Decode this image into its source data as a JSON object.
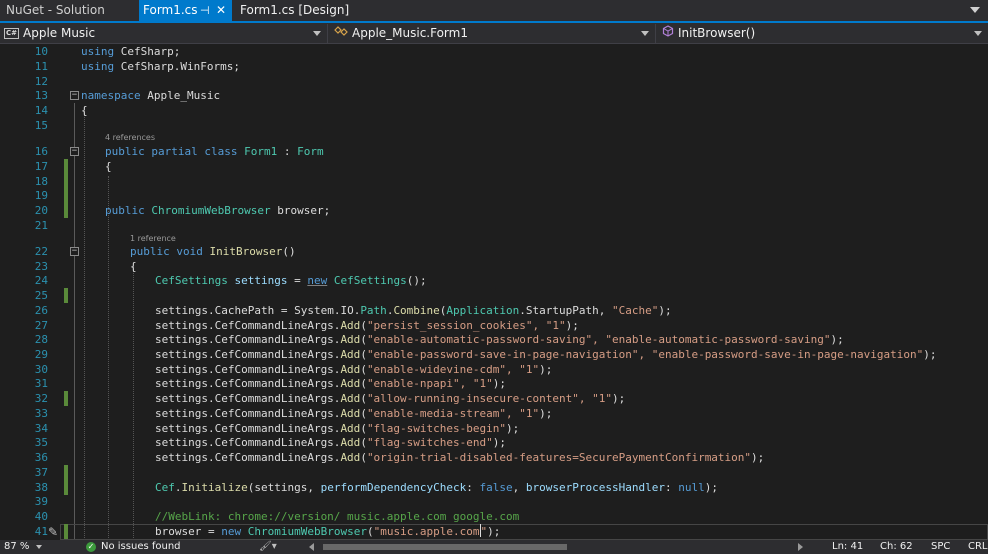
{
  "tabs": {
    "solution_label": "NuGet - Solution",
    "active_label": "Form1.cs",
    "design_label": "Form1.cs [Design]"
  },
  "navbar": {
    "project_badge": "C#",
    "project": "Apple Music",
    "class": "Apple_Music.Form1",
    "member": "InitBrowser()"
  },
  "editor": {
    "line_numbers": [
      "10",
      "11",
      "12",
      "13",
      "14",
      "15",
      "16",
      "17",
      "18",
      "19",
      "20",
      "21",
      "22",
      "23",
      "24",
      "25",
      "26",
      "27",
      "28",
      "29",
      "30",
      "31",
      "32",
      "33",
      "34",
      "35",
      "36",
      "37",
      "38",
      "39",
      "40",
      "41"
    ],
    "codelens": {
      "class_refs": "4 references",
      "method_refs": "1 reference"
    },
    "lines": {
      "l10_kw": "using",
      "l10_rest": " CefSharp;",
      "l11_kw": "using",
      "l11_rest": " CefSharp.WinForms;",
      "l13_kw": "namespace",
      "l13_rest": " Apple_Music",
      "l14": "{",
      "l16_kw": "public partial class",
      "l16_type": "Form1",
      "l16_colon": " : ",
      "l16_base": "Form",
      "l17": "{",
      "l20_kw": "public",
      "l20_type": "ChromiumWebBrowser",
      "l20_rest": " browser;",
      "l22_kw": "public void",
      "l22_name": "InitBrowser",
      "l22_rest": "()",
      "l23": "{",
      "l24_type": "CefSettings",
      "l24_var": "settings",
      "l24_eq": " = ",
      "l24_new": "new",
      "l24_type2": "CefSettings",
      "l24_end": "();",
      "l26_a": "settings.",
      "l26_b": "CachePath",
      "l26_c": " = System.IO.",
      "l26_d": "Path",
      "l26_e": ".",
      "l26_f": "Combine",
      "l26_g": "(",
      "l26_h": "Application",
      "l26_i": ".",
      "l26_j": "StartupPath",
      "l26_k": ", ",
      "l26_l": "\"Cache\"",
      "l26_m": ");",
      "args_prefix": "settings.CefCommandLineArgs.",
      "args_add": "Add",
      "l27_args": "\"persist_session_cookies\", \"1\"",
      "l28_args": "\"enable-automatic-password-saving\", \"enable-automatic-password-saving\"",
      "l29_args": "\"enable-password-save-in-page-navigation\", \"enable-password-save-in-page-navigation\"",
      "l30_args": "\"enable-widevine-cdm\", \"1\"",
      "l31_args": "\"enable-npapi\", \"1\"",
      "l32_args": "\"allow-running-insecure-content\", \"1\"",
      "l33_args": "\"enable-media-stream\", \"1\"",
      "l34_args": "\"flag-switches-begin\"",
      "l35_args": "\"flag-switches-end\"",
      "l36_args": "\"origin-trial-disabled-features=SecurePaymentConfirmation\"",
      "l38_a": "Cef",
      "l38_b": ".",
      "l38_c": "Initialize",
      "l38_d": "(settings, ",
      "l38_e": "performDependencyCheck",
      "l38_f": ": ",
      "l38_g": "false",
      "l38_h": ", ",
      "l38_i": "browserProcessHandler",
      "l38_j": ": ",
      "l38_k": "null",
      "l38_l": ");",
      "l40_comment": "//WebLink: chrome://version/ music.apple.com google.com",
      "l41_a": "browser = ",
      "l41_new": "new",
      "l41_type": "ChromiumWebBrowser",
      "l41_str_a": "\"music.apple.com",
      "l41_str_b": "\"",
      "l41_end": ");"
    }
  },
  "status": {
    "zoom": "87 %",
    "issues": "No issues found",
    "line": "Ln: 41",
    "char": "Ch: 62",
    "spc": "SPC",
    "crlf": "CRLF"
  },
  "colors": {
    "accent": "#007acc",
    "keyword": "#569cd6",
    "type": "#4ec9b0",
    "string": "#d69d85",
    "method": "#dcdcaa",
    "parameter": "#9cdcfe",
    "comment": "#57a64a",
    "line_number": "#2b91af",
    "change_marker": "#5a8a3a"
  }
}
